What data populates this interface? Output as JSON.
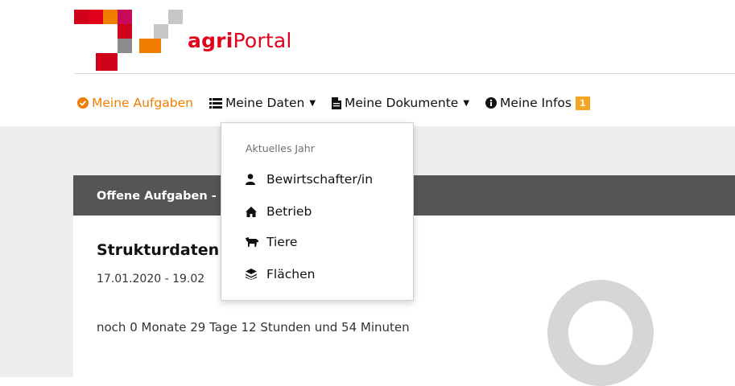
{
  "brand": {
    "name_bold": "agri",
    "name_rest": "Portal",
    "colors": {
      "red": "#d0021b",
      "orange": "#f07d00",
      "gray": "#8c8c8c",
      "light_gray": "#c6c6c6",
      "pink": "#e2001a"
    }
  },
  "nav": {
    "items": [
      {
        "label": "Meine Aufgaben",
        "icon": "check-circle-icon",
        "active": true
      },
      {
        "label": "Meine Daten",
        "icon": "list-icon",
        "caret": true
      },
      {
        "label": "Meine Dokumente",
        "icon": "document-icon",
        "caret": true
      },
      {
        "label": "Meine Infos",
        "icon": "info-circle-icon",
        "badge": "1"
      }
    ]
  },
  "dropdown": {
    "header": "Aktuelles Jahr",
    "items": [
      {
        "label": "Bewirtschafter/in",
        "icon": "user-icon"
      },
      {
        "label": "Betrieb",
        "icon": "home-icon"
      },
      {
        "label": "Tiere",
        "icon": "cow-icon"
      },
      {
        "label": "Flächen",
        "icon": "layers-icon"
      }
    ]
  },
  "panel": {
    "title": "Offene Aufgaben -",
    "task_title": "Strukturdaten",
    "task_date": "17.01.2020 - 19.02",
    "task_remaining": "noch 0 Monate 29 Tage 12 Stunden und 54 Minuten"
  }
}
